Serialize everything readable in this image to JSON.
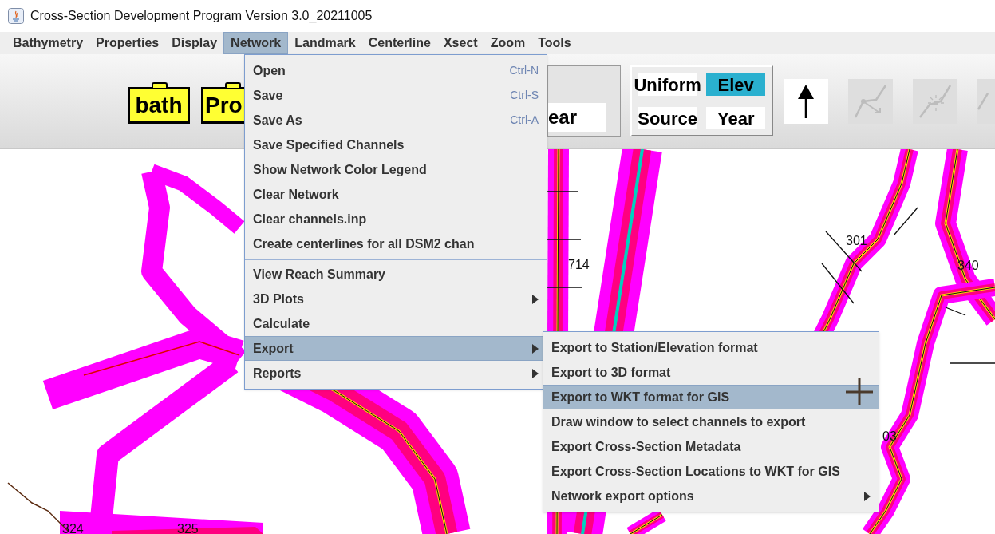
{
  "window": {
    "title": "Cross-Section Development Program Version 3.0_20211005"
  },
  "menu_bar": [
    {
      "label": "Bathymetry",
      "selected": false
    },
    {
      "label": "Properties",
      "selected": false
    },
    {
      "label": "Display",
      "selected": false
    },
    {
      "label": "Network",
      "selected": true
    },
    {
      "label": "Landmark",
      "selected": false
    },
    {
      "label": "Centerline",
      "selected": false
    },
    {
      "label": "Xsect",
      "selected": false
    },
    {
      "label": "Zoom",
      "selected": false
    },
    {
      "label": "Tools",
      "selected": false
    }
  ],
  "toolbar": {
    "file_buttons": [
      "bath",
      "Pro"
    ],
    "partial_button": "ear",
    "view_toggle": [
      {
        "label": "Uniform",
        "selected": false
      },
      {
        "label": "Elev",
        "selected": true
      },
      {
        "label": "Source",
        "selected": false
      },
      {
        "label": "Year",
        "selected": false
      }
    ],
    "tools": [
      {
        "kind": "arrow",
        "disabled": false
      },
      {
        "kind": "move-point",
        "disabled": true
      },
      {
        "kind": "insert-point",
        "disabled": true
      },
      {
        "kind": "line",
        "disabled": true
      }
    ]
  },
  "network_menu": [
    {
      "label": "Open",
      "shortcut": "Ctrl-N",
      "selected": false,
      "has_submenu": false,
      "separator_before": false
    },
    {
      "label": "Save",
      "shortcut": "Ctrl-S",
      "selected": false,
      "has_submenu": false,
      "separator_before": false
    },
    {
      "label": "Save As",
      "shortcut": "Ctrl-A",
      "selected": false,
      "has_submenu": false,
      "separator_before": false
    },
    {
      "label": "Save Specified Channels",
      "selected": false,
      "has_submenu": false,
      "separator_before": false
    },
    {
      "label": "Show Network Color Legend",
      "selected": false,
      "has_submenu": false,
      "separator_before": false
    },
    {
      "label": "Clear Network",
      "selected": false,
      "has_submenu": false,
      "separator_before": false
    },
    {
      "label": "Clear channels.inp",
      "selected": false,
      "has_submenu": false,
      "separator_before": false
    },
    {
      "label": "Create centerlines for all DSM2 chan",
      "selected": false,
      "has_submenu": false,
      "separator_before": false
    },
    {
      "label": "View Reach Summary",
      "selected": false,
      "has_submenu": false,
      "separator_before": true
    },
    {
      "label": "3D Plots",
      "selected": false,
      "has_submenu": true,
      "separator_before": false
    },
    {
      "label": "Calculate",
      "selected": false,
      "has_submenu": false,
      "separator_before": false
    },
    {
      "label": "Export",
      "selected": true,
      "has_submenu": true,
      "separator_before": false
    },
    {
      "label": "Reports",
      "selected": false,
      "has_submenu": true,
      "separator_before": false
    }
  ],
  "export_submenu": [
    {
      "label": "Export to Station/Elevation format",
      "selected": false,
      "has_submenu": false
    },
    {
      "label": "Export to 3D format",
      "selected": false,
      "has_submenu": false
    },
    {
      "label": "Export to WKT format for GIS",
      "selected": true,
      "has_submenu": false
    },
    {
      "label": "Draw window to select channels to export",
      "selected": false,
      "has_submenu": false
    },
    {
      "label": "Export Cross-Section Metadata",
      "selected": false,
      "has_submenu": false
    },
    {
      "label": "Export Cross-Section Locations to WKT for GIS",
      "selected": false,
      "has_submenu": false
    },
    {
      "label": "Network export options",
      "selected": false,
      "has_submenu": true
    }
  ],
  "map": {
    "channel_labels": [
      "714",
      "301",
      "340",
      "03",
      "324",
      "325"
    ]
  }
}
